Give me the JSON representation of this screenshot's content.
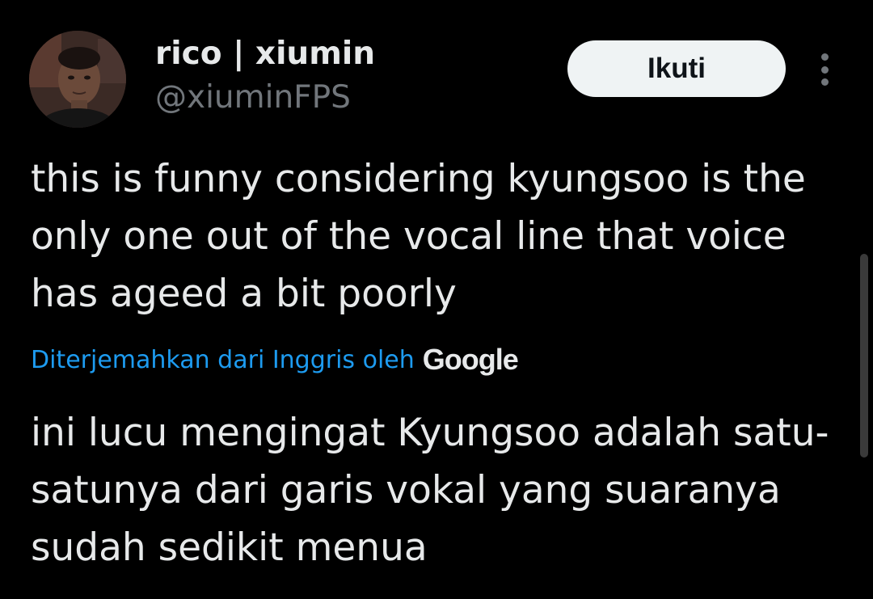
{
  "user": {
    "display_name": "rico | xiumin",
    "handle": "@xiuminFPS"
  },
  "actions": {
    "follow_label": "Ikuti",
    "more_icon": "more-vertical-icon"
  },
  "tweet": {
    "text": "this is funny considering kyungsoo is the only one out of the vocal line that voice has ageed a bit poorly",
    "translation_credit": "Diterjemahkan dari Inggris oleh",
    "translation_provider": "Google",
    "translated_text": "ini lucu mengingat Kyungsoo adalah satu-satunya dari garis vokal yang suaranya sudah sedikit menua"
  },
  "colors": {
    "background": "#000000",
    "text": "#e7e9ea",
    "secondary_text": "#71767b",
    "link": "#1d9bf0",
    "button_bg": "#eff3f4",
    "button_text": "#0f1419"
  }
}
